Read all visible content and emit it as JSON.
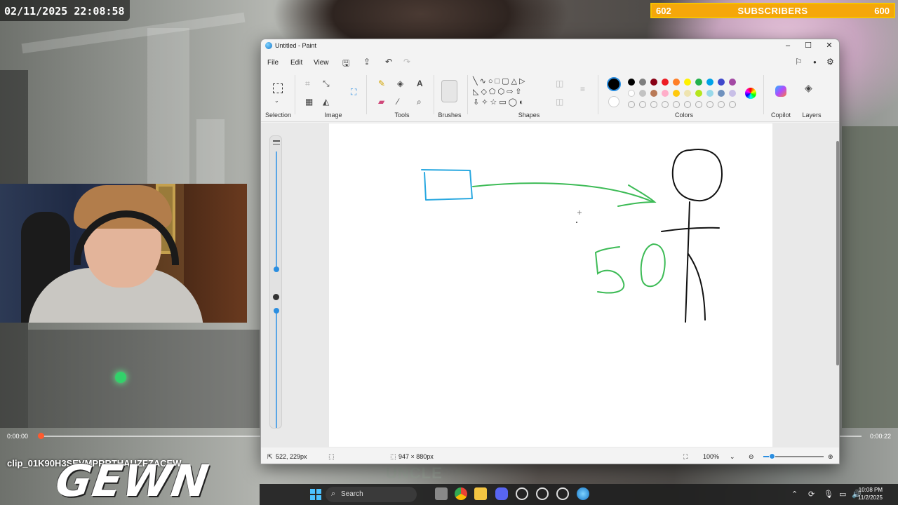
{
  "overlay": {
    "timestamp": "02/11/2025 22:08:58",
    "subscribers": {
      "current": "602",
      "label": "SUBSCRIBERS",
      "goal": "600"
    },
    "clip_name": "clip_01K90H3SEVMPRRTHAUZFZACEW",
    "brand": "GEWN",
    "watermark": "UNCLE"
  },
  "player": {
    "time_current": "0:00:00",
    "time_total": "0:00:22",
    "progress": 0.0
  },
  "paint": {
    "title": "Untitled - Paint",
    "menu": [
      "File",
      "Edit",
      "View"
    ],
    "ribbon_groups": {
      "selection": "Selection",
      "image": "Image",
      "tools": "Tools",
      "brushes": "Brushes",
      "shapes": "Shapes",
      "colors": "Colors",
      "copilot": "Copilot",
      "layers": "Layers"
    },
    "palette_row1": [
      "#000000",
      "#7f7f7f",
      "#880015",
      "#ed1c24",
      "#ff7f27",
      "#fff200",
      "#22b14c",
      "#00a2e8",
      "#3f48cc",
      "#a349a4"
    ],
    "palette_row2": [
      "#ffffff",
      "#c3c3c3",
      "#b97a57",
      "#ffaec9",
      "#ffc90e",
      "#efe4b0",
      "#b5e61d",
      "#99d9ea",
      "#7092be",
      "#c8bfe7"
    ],
    "primary_color": "#000000",
    "secondary_color": "#ffffff",
    "status": {
      "cursor_pos": "522, 229px",
      "canvas_size": "947 × 880px",
      "zoom": "100%"
    },
    "drawing": {
      "rectangle_color": "#29a8e0",
      "arrow_color": "#3dbb56",
      "text_50_color": "#3dbb56",
      "stick_figure_color": "#111111",
      "scribbled_text": "50"
    }
  },
  "taskbar": {
    "search_placeholder": "Search",
    "time": "10:08 PM",
    "date": "11/2/2025"
  }
}
